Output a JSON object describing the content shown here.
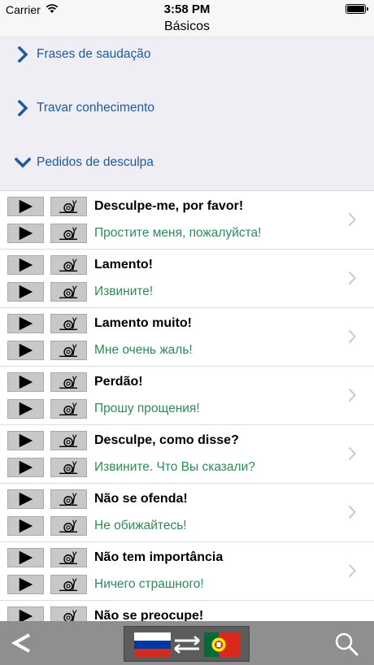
{
  "status_bar": {
    "carrier": "Carrier",
    "time": "3:58 PM"
  },
  "nav": {
    "title": "Básicos"
  },
  "sections": [
    {
      "label": "Frases de saudação",
      "expanded": false
    },
    {
      "label": "Travar conhecimento",
      "expanded": false
    },
    {
      "label": "Pedidos de desculpa",
      "expanded": true
    }
  ],
  "phrases": [
    {
      "pt": "Desculpe-me, por favor!",
      "ru": "Простите меня, пожалуйста!"
    },
    {
      "pt": "Lamento!",
      "ru": "Извините!"
    },
    {
      "pt": "Lamento muito!",
      "ru": "Мне очень жаль!"
    },
    {
      "pt": "Perdão!",
      "ru": "Прошу прощения!"
    },
    {
      "pt": "Desculpe, como disse?",
      "ru": "Извините. Что Вы сказали?"
    },
    {
      "pt": "Não se ofenda!",
      "ru": "Не обижайтесь!"
    },
    {
      "pt": "Não tem importância",
      "ru": "Ничего страшного!"
    },
    {
      "pt": "Não se preocupe!",
      "ru": ""
    }
  ],
  "toolbar": {
    "back_icon": "back-chevron-icon",
    "lang_from": "russia-flag-icon",
    "lang_to": "portugal-flag-icon",
    "search_icon": "search-icon"
  },
  "colors": {
    "section_bg": "#eeeef4",
    "section_text": "#1f5a9e",
    "translation_text": "#2e8b57",
    "toolbar_bg": "#8f8f8f"
  }
}
